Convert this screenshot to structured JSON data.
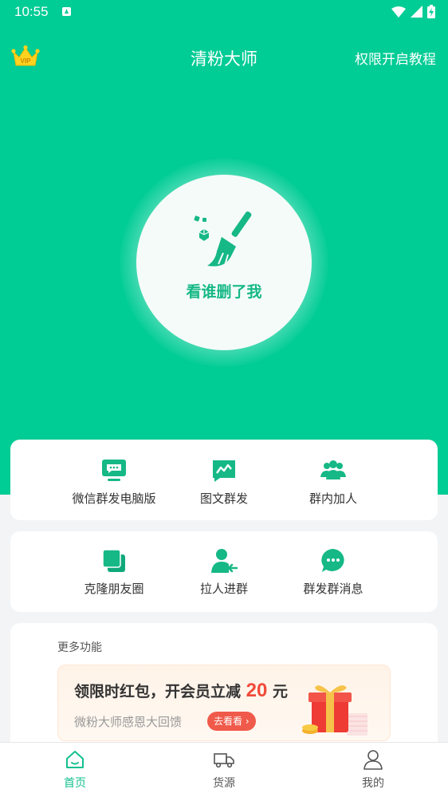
{
  "status_bar": {
    "time": "10:55"
  },
  "app_bar": {
    "title": "清粉大师",
    "permission_link": "权限开启教程",
    "vip_badge": "VIP"
  },
  "hero": {
    "label": "看谁删了我"
  },
  "features_row1": [
    {
      "label": "微信群发电脑版",
      "icon": "monitor-chat-icon"
    },
    {
      "label": "图文群发",
      "icon": "image-chat-icon"
    },
    {
      "label": "群内加人",
      "icon": "group-users-icon"
    }
  ],
  "features_row2": [
    {
      "label": "克隆朋友圈",
      "icon": "copy-icon"
    },
    {
      "label": "拉人进群",
      "icon": "user-pull-icon"
    },
    {
      "label": "群发群消息",
      "icon": "chat-bubble-icon"
    }
  ],
  "more": {
    "title": "更多功能",
    "promo": {
      "text_before": "领限时红包，开会员立减",
      "amount": "20",
      "unit": "元",
      "subtitle": "微粉大师感恩大回馈",
      "button": "去看看"
    }
  },
  "tabs": [
    {
      "label": "首页",
      "icon": "home-icon",
      "active": true
    },
    {
      "label": "货源",
      "icon": "truck-icon",
      "active": false
    },
    {
      "label": "我的",
      "icon": "user-icon",
      "active": false
    }
  ],
  "colors": {
    "primary": "#00cc95",
    "accent_red": "#f04a3a",
    "tab_active": "#13c08e"
  }
}
